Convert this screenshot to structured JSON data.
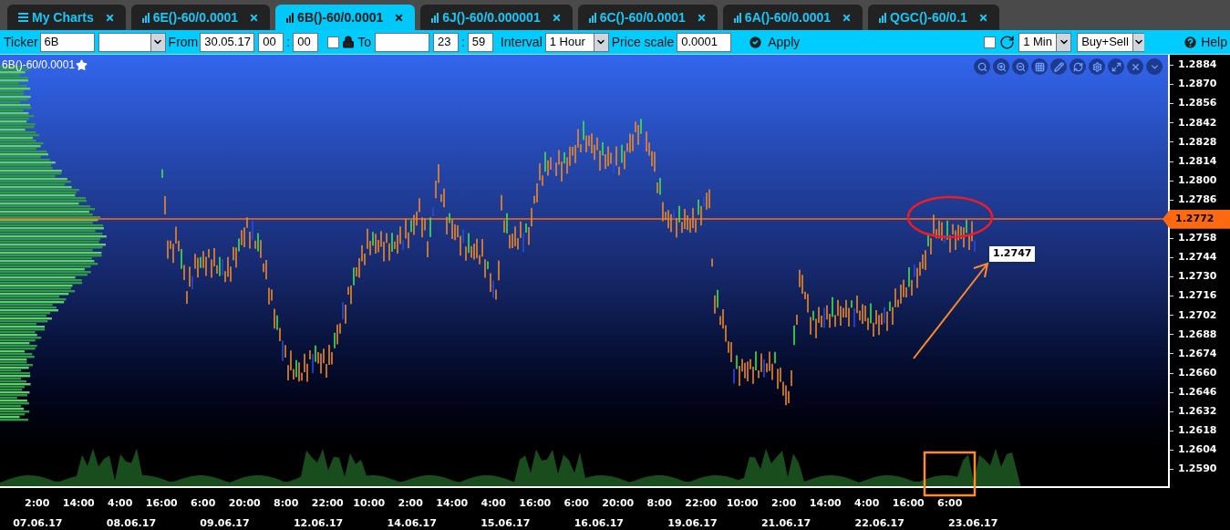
{
  "tabs": [
    {
      "label": "My Charts",
      "kind": "menu",
      "selected": false
    },
    {
      "label": "6E()-60/0.0001",
      "kind": "chart",
      "selected": false
    },
    {
      "label": "6B()-60/0.0001",
      "kind": "chart",
      "selected": true
    },
    {
      "label": "6J()-60/0.000001",
      "kind": "chart",
      "selected": false
    },
    {
      "label": "6C()-60/0.0001",
      "kind": "chart",
      "selected": false
    },
    {
      "label": "6A()-60/0.0001",
      "kind": "chart",
      "selected": false
    },
    {
      "label": "QGC()-60/0.1",
      "kind": "chart",
      "selected": false
    }
  ],
  "toolbar": {
    "ticker_label": "Ticker",
    "ticker_value": "6B",
    "from_label": "From",
    "from_date": "30.05.17",
    "from_hour": "00",
    "from_separator": ":",
    "from_minute": "00",
    "lock_checkbox": {
      "checked": false
    },
    "to_label": "To",
    "to_hour": "23",
    "to_separator": ":",
    "to_minute": "59",
    "interval_label": "Interval",
    "interval_value": "1 Hour",
    "price_scale_label": "Price scale",
    "price_scale_value": "0.0001",
    "apply_button": "Apply",
    "auto_checkbox": {
      "checked": false
    },
    "period_value": "1 Min",
    "side_value": "Buy+Sell",
    "help_button": "Help"
  },
  "chart": {
    "title": "6B()-60/0.0001",
    "price_marker": "1.2747",
    "price_axis": [
      {
        "label": "1.2884",
        "kind": "tick"
      },
      {
        "label": "1.2870",
        "kind": "tick"
      },
      {
        "label": "1.2856",
        "kind": "tick"
      },
      {
        "label": "1.2842",
        "kind": "tick"
      },
      {
        "label": "1.2828",
        "kind": "tick"
      },
      {
        "label": "1.2814",
        "kind": "tick"
      },
      {
        "label": "1.2800",
        "kind": "tick"
      },
      {
        "label": "1.2786",
        "kind": "tick"
      },
      {
        "label": "1.2772",
        "kind": "current"
      },
      {
        "label": "1.2758",
        "kind": "tick"
      },
      {
        "label": "1.2744",
        "kind": "tick"
      },
      {
        "label": "1.2730",
        "kind": "tick"
      },
      {
        "label": "1.2716",
        "kind": "tick"
      },
      {
        "label": "1.2702",
        "kind": "tick"
      },
      {
        "label": "1.2688",
        "kind": "tick"
      },
      {
        "label": "1.2674",
        "kind": "tick"
      },
      {
        "label": "1.2660",
        "kind": "tick"
      },
      {
        "label": "1.2646",
        "kind": "tick"
      },
      {
        "label": "1.2632",
        "kind": "tick"
      },
      {
        "label": "1.2618",
        "kind": "tick"
      },
      {
        "label": "1.2604",
        "kind": "tick"
      },
      {
        "label": "1.2590",
        "kind": "tick"
      }
    ],
    "time_axis": {
      "times": [
        "2:00",
        "14:00",
        "4:00",
        "16:00",
        "6:00",
        "20:00",
        "8:00",
        "22:00",
        "10:00",
        "2:00",
        "14:00",
        "4:00",
        "16:00",
        "6:00",
        "20:00",
        "8:00",
        "22:00",
        "10:00",
        "2:00",
        "14:00",
        "4:00",
        "16:00",
        "6:00"
      ],
      "dates": [
        "07.06.17",
        "08.06.17",
        "09.06.17",
        "12.06.17",
        "14.06.17",
        "15.06.17",
        "16.06.17",
        "19.06.17",
        "21.06.17",
        "22.06.17",
        "23.06.17"
      ]
    }
  }
}
